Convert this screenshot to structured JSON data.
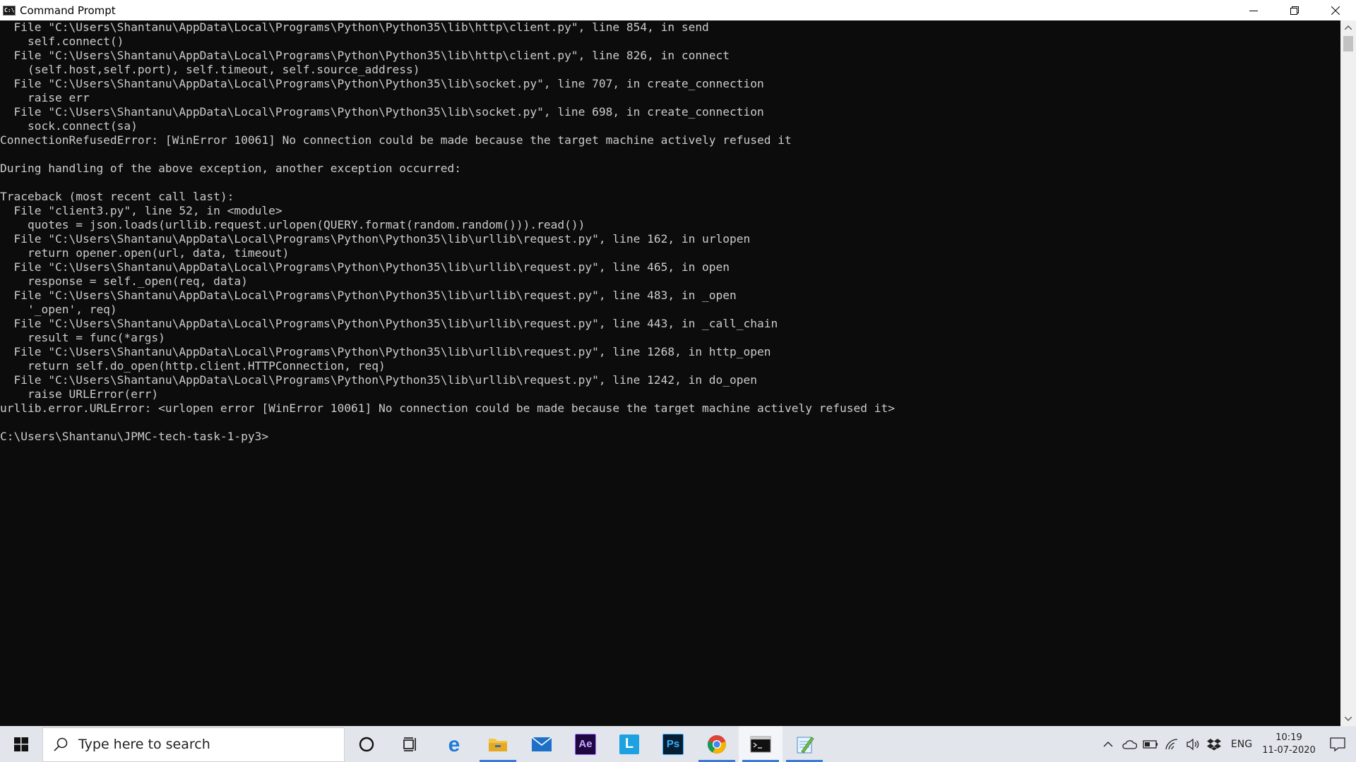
{
  "window": {
    "title": "Command Prompt",
    "controls": {
      "minimize": "minimize",
      "restore": "restore",
      "close": "close"
    }
  },
  "console": {
    "lines": [
      "  File \"C:\\Users\\Shantanu\\AppData\\Local\\Programs\\Python\\Python35\\lib\\http\\client.py\", line 854, in send",
      "    self.connect()",
      "  File \"C:\\Users\\Shantanu\\AppData\\Local\\Programs\\Python\\Python35\\lib\\http\\client.py\", line 826, in connect",
      "    (self.host,self.port), self.timeout, self.source_address)",
      "  File \"C:\\Users\\Shantanu\\AppData\\Local\\Programs\\Python\\Python35\\lib\\socket.py\", line 707, in create_connection",
      "    raise err",
      "  File \"C:\\Users\\Shantanu\\AppData\\Local\\Programs\\Python\\Python35\\lib\\socket.py\", line 698, in create_connection",
      "    sock.connect(sa)",
      "ConnectionRefusedError: [WinError 10061] No connection could be made because the target machine actively refused it",
      "",
      "During handling of the above exception, another exception occurred:",
      "",
      "Traceback (most recent call last):",
      "  File \"client3.py\", line 52, in <module>",
      "    quotes = json.loads(urllib.request.urlopen(QUERY.format(random.random())).read())",
      "  File \"C:\\Users\\Shantanu\\AppData\\Local\\Programs\\Python\\Python35\\lib\\urllib\\request.py\", line 162, in urlopen",
      "    return opener.open(url, data, timeout)",
      "  File \"C:\\Users\\Shantanu\\AppData\\Local\\Programs\\Python\\Python35\\lib\\urllib\\request.py\", line 465, in open",
      "    response = self._open(req, data)",
      "  File \"C:\\Users\\Shantanu\\AppData\\Local\\Programs\\Python\\Python35\\lib\\urllib\\request.py\", line 483, in _open",
      "    '_open', req)",
      "  File \"C:\\Users\\Shantanu\\AppData\\Local\\Programs\\Python\\Python35\\lib\\urllib\\request.py\", line 443, in _call_chain",
      "    result = func(*args)",
      "  File \"C:\\Users\\Shantanu\\AppData\\Local\\Programs\\Python\\Python35\\lib\\urllib\\request.py\", line 1268, in http_open",
      "    return self.do_open(http.client.HTTPConnection, req)",
      "  File \"C:\\Users\\Shantanu\\AppData\\Local\\Programs\\Python\\Python35\\lib\\urllib\\request.py\", line 1242, in do_open",
      "    raise URLError(err)",
      "urllib.error.URLError: <urlopen error [WinError 10061] No connection could be made because the target machine actively refused it>",
      "",
      "C:\\Users\\Shantanu\\JPMC-tech-task-1-py3>"
    ]
  },
  "taskbar": {
    "search_placeholder": "Type here to search",
    "apps": [
      {
        "name": "cortana",
        "icon": "cortana-circle-icon"
      },
      {
        "name": "task-view",
        "icon": "task-view-icon"
      },
      {
        "name": "edge",
        "icon": "edge-icon"
      },
      {
        "name": "file-explorer",
        "icon": "folder-icon"
      },
      {
        "name": "mail",
        "icon": "mail-icon"
      },
      {
        "name": "after-effects",
        "icon": "after-effects-icon",
        "label": "Ae"
      },
      {
        "name": "l-app",
        "icon": "l-app-icon",
        "label": "L"
      },
      {
        "name": "photoshop",
        "icon": "photoshop-icon",
        "label": "Ps"
      },
      {
        "name": "chrome",
        "icon": "chrome-icon"
      },
      {
        "name": "command-prompt",
        "icon": "terminal-icon"
      },
      {
        "name": "notepad",
        "icon": "notepad-icon"
      }
    ],
    "tray": {
      "language": "ENG",
      "time": "10:19",
      "date": "11-07-2020"
    }
  },
  "colors": {
    "console_bg": "#0c0c0c",
    "console_fg": "#cccccc",
    "taskbar_bg": "#e2e6ec",
    "active_indicator": "#3a7bd5"
  }
}
